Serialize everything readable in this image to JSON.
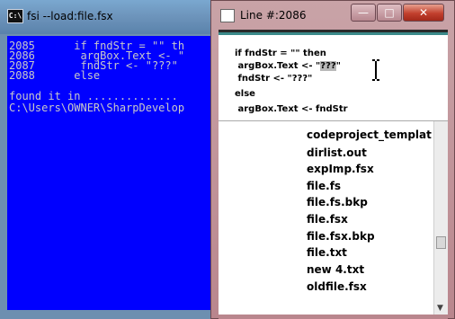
{
  "console": {
    "title": "fsi  --load:file.fsx",
    "icon_label": "C:\\",
    "lines": [
      "2085      if fndStr = \"\" th",
      "2086       argBox.Text <- \"",
      "2087       fndStr <- \"???\"",
      "2088      else",
      "",
      "found it in ..............",
      "C:\\Users\\OWNER\\SharpDevelop"
    ]
  },
  "line_window": {
    "title": "Line #:2086",
    "minimize": "—",
    "maximize": "□",
    "close": "✕",
    "code_lines": [
      "if fndStr = \"\" then",
      " argBox.Text <- \"",
      " fndStr <- \"???\"",
      "else",
      " argBox.Text <- fndStr"
    ],
    "highlight_text": "???",
    "after_highlight": "\"",
    "files": [
      "codeproject_templat",
      "dirlist.out",
      "expImp.fsx",
      "file.fs",
      "file.fs.bkp",
      "file.fsx",
      "file.fsx.bkp",
      "file.txt",
      "new  4.txt",
      "oldfile.fsx"
    ]
  }
}
